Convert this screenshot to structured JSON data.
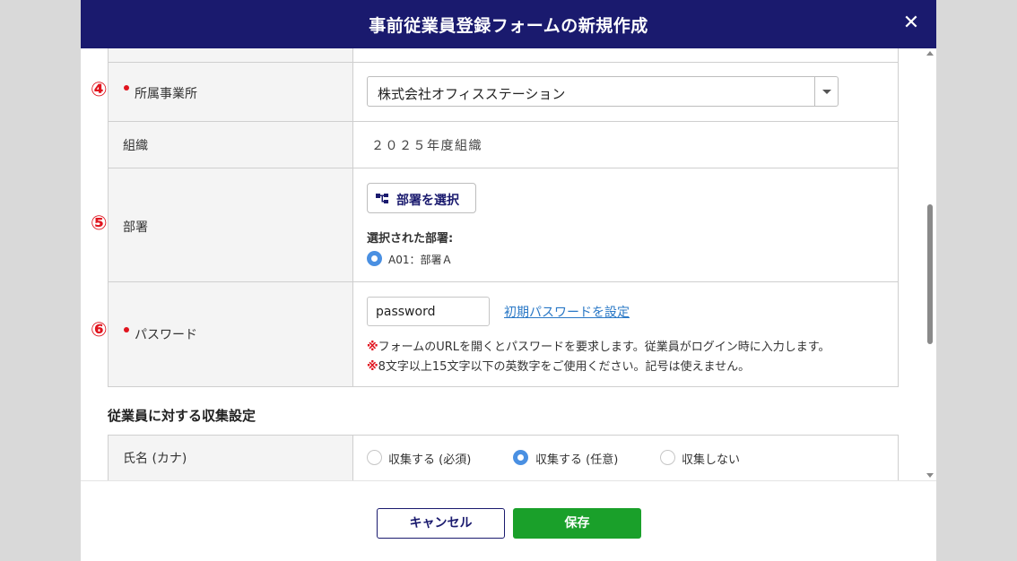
{
  "modal": {
    "title": "事前従業員登録フォームの新規作成",
    "close_glyph": "✕"
  },
  "rows": {
    "office": {
      "marker": "④",
      "label": "所属事業所",
      "required": true,
      "selected_value": "株式会社オフィスステーション"
    },
    "organization": {
      "label": "組織",
      "value": "２０２５年度組織"
    },
    "department": {
      "marker": "⑤",
      "label": "部署",
      "select_button": "部署を選択",
      "selected_heading": "選択された部署:",
      "selected_item": "A01：部署Ａ"
    },
    "password": {
      "marker": "⑥",
      "label": "パスワード",
      "required": true,
      "input_value": "password",
      "set_initial_link": "初期パスワードを設定",
      "note_mark": "※",
      "note1": "フォームのURLを開くとパスワードを要求します。従業員がログイン時に入力します。",
      "note2": "8文字以上15文字以下の英数字をご使用ください。記号は使えません。"
    }
  },
  "collection_section": {
    "heading": "従業員に対する収集設定",
    "row": {
      "label": "氏名 (カナ)",
      "options": [
        {
          "label": "収集する (必須)",
          "checked": false
        },
        {
          "label": "収集する (任意)",
          "checked": true
        },
        {
          "label": "収集しない",
          "checked": false
        }
      ]
    }
  },
  "footer": {
    "cancel_label": "キャンセル",
    "save_label": "保存"
  },
  "colors": {
    "header_bg": "#1a1a6e",
    "required_red": "#e0141e",
    "link_blue": "#2a78c6",
    "save_green": "#1aa02a",
    "radio_blue": "#4a90e2"
  }
}
